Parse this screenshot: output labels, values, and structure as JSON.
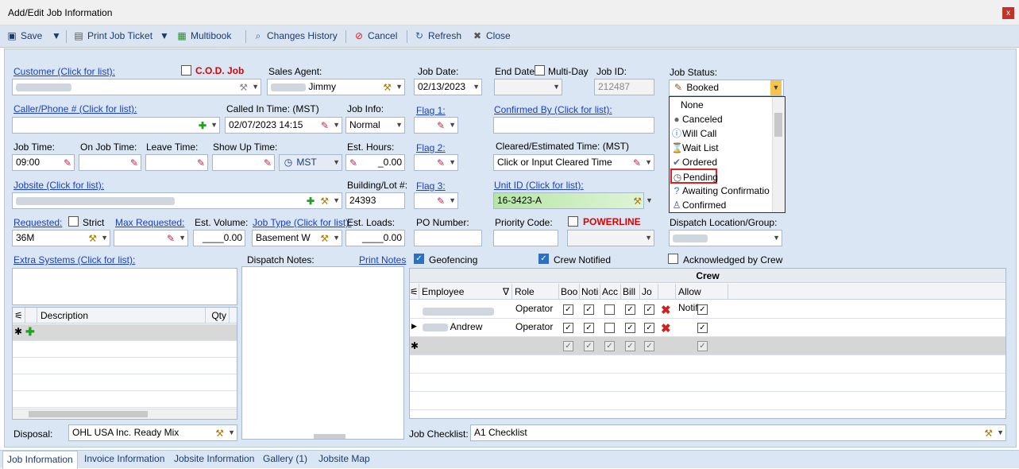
{
  "window": {
    "title": "Add/Edit Job Information",
    "close": "x"
  },
  "toolbar": {
    "save": "Save",
    "print": "Print Job Ticket",
    "multibook": "Multibook",
    "history": "Changes History",
    "cancel": "Cancel",
    "refresh": "Refresh",
    "close": "Close"
  },
  "form": {
    "customer_label": "Customer (Click for list):",
    "cod_label": "C.O.D. Job",
    "sales_agent_label": "Sales Agent:",
    "sales_agent_value": "Jimmy",
    "job_date_label": "Job Date:",
    "job_date_value": "02/13/2023",
    "end_date_label": "End Date:",
    "multiday_label": "Multi-Day",
    "job_id_label": "Job ID:",
    "job_id_value": "212487",
    "job_status_label": "Job Status:",
    "job_status_value": "Booked",
    "caller_label": "Caller/Phone # (Click for list):",
    "called_in_label": "Called In Time: (MST)",
    "called_in_value": "02/07/2023 14:15",
    "job_info_label": "Job Info:",
    "job_info_value": "Normal",
    "flag1_label": "Flag 1:",
    "confirmed_by_label": "Confirmed By (Click for list):",
    "job_time_label": "Job Time:",
    "job_time_value": "09:00",
    "on_job_label": "On Job Time:",
    "leave_label": "Leave Time:",
    "show_up_label": "Show Up Time:",
    "tz_value": "MST",
    "est_hours_label": "Est. Hours:",
    "est_hours_value": "_0.00",
    "flag2_label": "Flag 2:",
    "cleared_label": "Cleared/Estimated Time: (MST)",
    "cleared_placeholder": "Click or Input Cleared Time",
    "jobsite_label": "Jobsite (Click for list):",
    "building_label": "Building/Lot #:",
    "building_value": "24393",
    "flag3_label": "Flag 3:",
    "unit_label": "Unit ID (Click for list):",
    "unit_value": "16-3423-A",
    "requested_label": "Requested:",
    "strict_label": "Strict",
    "max_req_label": "Max Requested:",
    "est_volume_label": "Est. Volume:",
    "est_volume_value": "____0.00",
    "job_type_label": "Job Type (Click for list):",
    "job_type_value": "Basement W",
    "est_loads_label": "Est. Loads:",
    "est_loads_value": "____0.00",
    "po_label": "PO Number:",
    "priority_label": "Priority Code:",
    "powerline_label": "POWERLINE",
    "dispatch_loc_label": "Dispatch Location/Group:",
    "requested_value": "36M",
    "extra_label": "Extra Systems (Click for list):",
    "dispatch_notes_label": "Dispatch Notes:",
    "print_notes": "Print Notes",
    "geofencing_label": "Geofencing",
    "crew_notified_label": "Crew Notified",
    "ack_label": "Acknowledged by Crew",
    "disposal_label": "Disposal:",
    "disposal_value": "OHL USA Inc. Ready Mix",
    "checklist_label": "Job Checklist:",
    "checklist_value": "A1 Checklist"
  },
  "status_options": [
    "None",
    "Canceled",
    "Will Call",
    "Wait List",
    "Ordered",
    "Pending",
    "Awaiting Confirmatio",
    "Confirmed"
  ],
  "extra_grid": {
    "headers": [
      "Description",
      "Qty"
    ]
  },
  "crew": {
    "title": "Crew",
    "headers": [
      "Employee",
      "Role",
      "Boo",
      "Noti",
      "Acc",
      "Bill",
      "Jo",
      "Allow Notify"
    ],
    "rows": [
      {
        "name": "",
        "role": "Operator"
      },
      {
        "name": "Andrew",
        "role": "Operator"
      }
    ]
  },
  "tabs": [
    "Job Information",
    "Invoice Information",
    "Jobsite Information",
    "Gallery (1)",
    "Jobsite Map"
  ]
}
